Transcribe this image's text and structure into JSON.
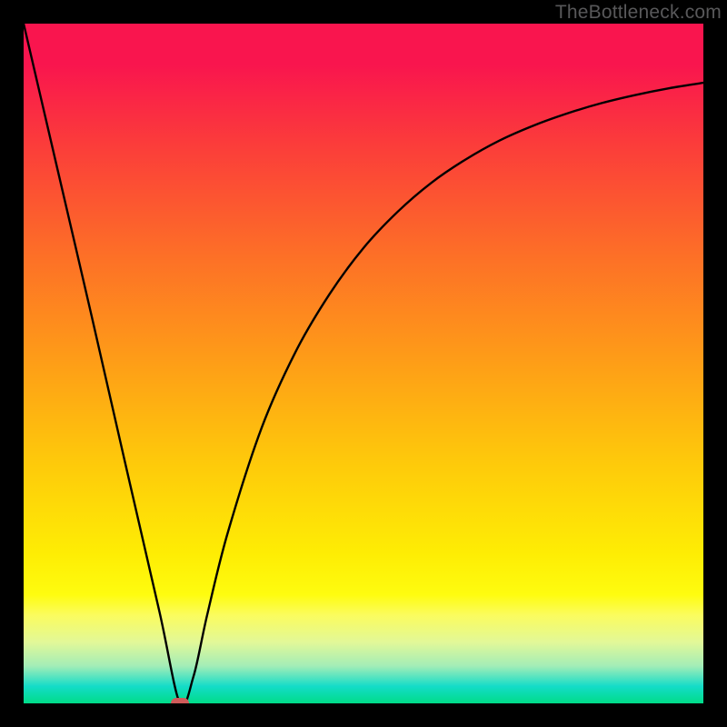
{
  "watermark": "TheBottleneck.com",
  "chart_data": {
    "type": "line",
    "title": "",
    "xlabel": "",
    "ylabel": "",
    "xlim": [
      0,
      100
    ],
    "ylim": [
      0,
      100
    ],
    "grid": false,
    "legend": false,
    "series": [
      {
        "name": "curve",
        "x": [
          0,
          5,
          10,
          15,
          20,
          23,
          25,
          27,
          30,
          35,
          40,
          45,
          50,
          55,
          60,
          65,
          70,
          75,
          80,
          85,
          90,
          95,
          100
        ],
        "y": [
          100,
          78.5,
          57,
          35.1,
          13.4,
          0,
          4,
          13,
          25,
          40.5,
          51.7,
          60.2,
          67,
          72.3,
          76.6,
          80,
          82.8,
          85,
          86.8,
          88.3,
          89.5,
          90.5,
          91.3
        ]
      }
    ],
    "marker": {
      "name": "bottleneck-point",
      "x": 23,
      "y": 0,
      "color": "#cf5b5a"
    },
    "background_gradient": {
      "top": "#f9154e",
      "mid": "#fee005",
      "bottom": "#00dc88"
    },
    "curve_color": "#000000"
  }
}
